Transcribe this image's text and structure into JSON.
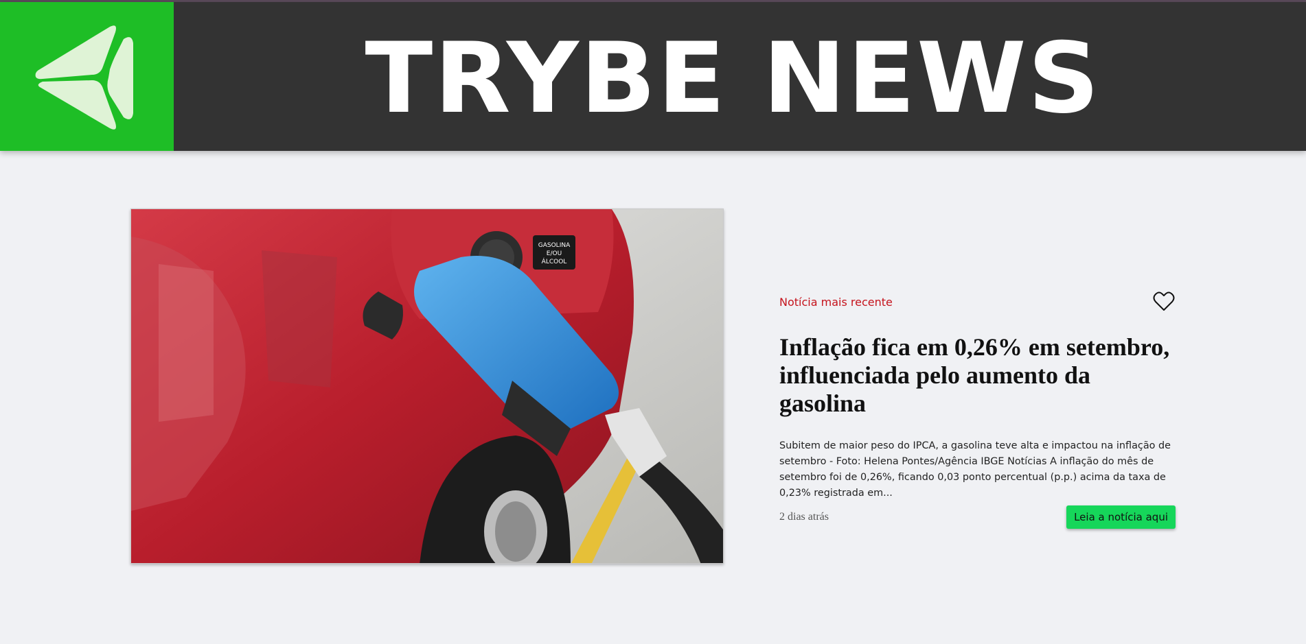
{
  "header": {
    "site_title": "TRYBE NEWS",
    "logo_icon": "trybe-logo-icon",
    "brand_green": "#1ebe26",
    "header_bg": "#333333"
  },
  "featured_news": {
    "label": "Notícia mais recente",
    "title": "Inflação fica em 0,26% em setembro, influenciada pelo aumento da gasolina",
    "excerpt": "Subitem de maior peso do IPCA, a gasolina teve alta e impactou na inflação de setembro - Foto: Helena Pontes/Agência IBGE Notícias A inflação do mês de setembro foi de 0,26%, ficando 0,03 ponto percentual (p.p.) acima da taxa de 0,23% registrada em...",
    "time_ago": "2 dias atrás",
    "read_button_label": "Leia a notícia aqui",
    "favorite_icon": "heart-outline-icon",
    "label_color": "#c5121b",
    "button_color": "#16d65a",
    "image_text": "GASOLINA E/OU ÁLCOOL"
  }
}
